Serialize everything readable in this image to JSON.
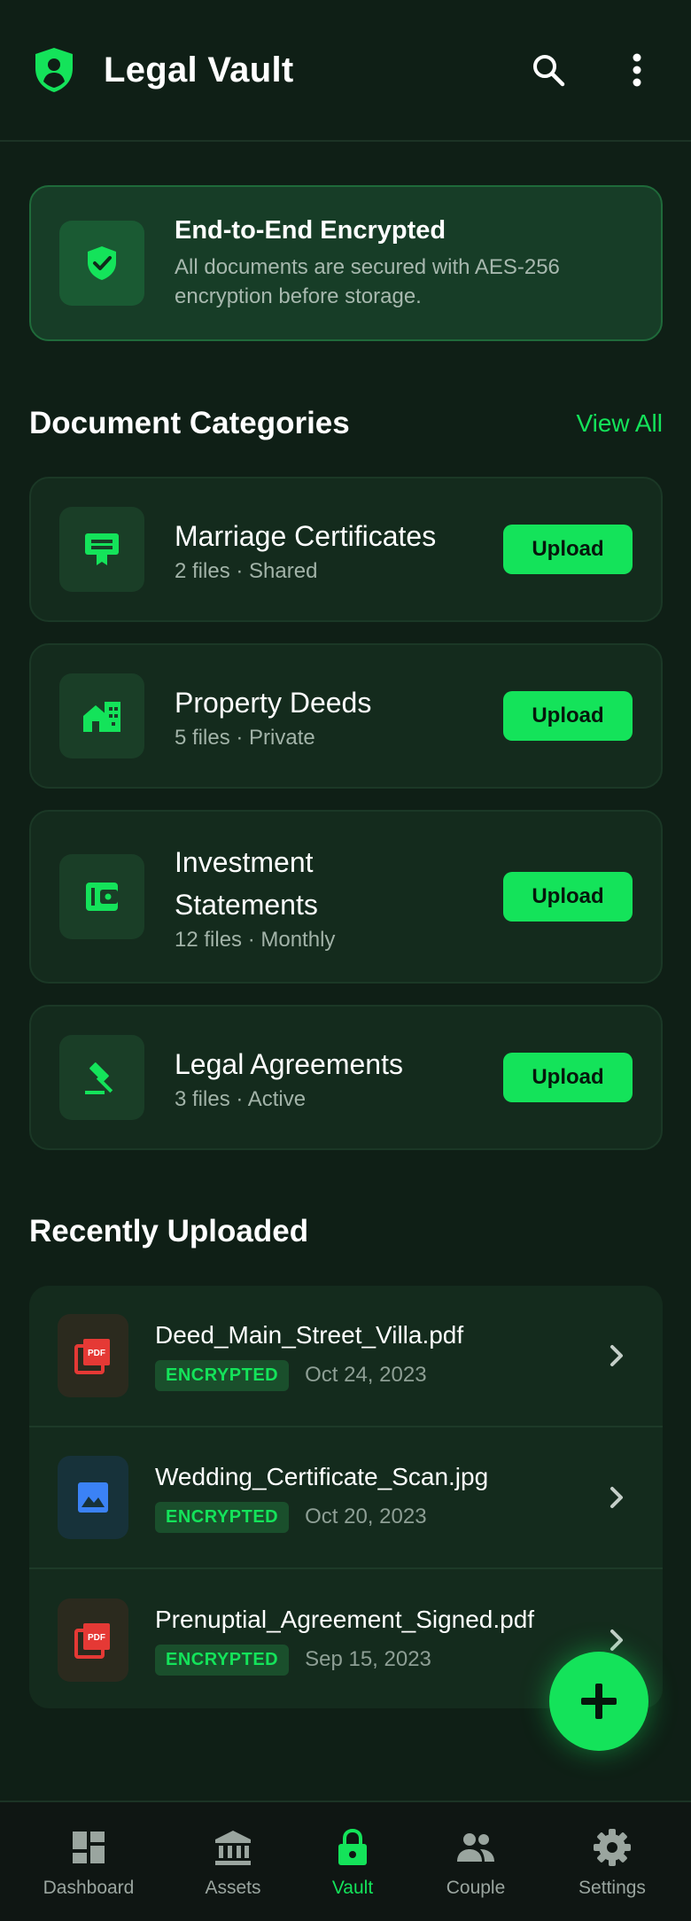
{
  "header": {
    "title": "Legal Vault",
    "brand_icon": "shield-person-icon",
    "search_icon": "search-icon",
    "more_icon": "more-vert-icon"
  },
  "banner": {
    "title": "End-to-End Encrypted",
    "description": "All documents are secured with AES-256 encryption before storage.",
    "icon": "shield-check-icon"
  },
  "categories": {
    "title": "Document Categories",
    "view_all": "View All",
    "items": [
      {
        "name": "Marriage Certificates",
        "meta": "2 files · Shared",
        "icon": "certificate-icon",
        "button": "Upload"
      },
      {
        "name": "Property Deeds",
        "meta": "5 files · Private",
        "icon": "house-icon",
        "button": "Upload"
      },
      {
        "name": "Investment Statements",
        "meta": "12 files · Monthly",
        "icon": "wallet-icon",
        "button": "Upload"
      },
      {
        "name": "Legal Agreements",
        "meta": "3 files · Active",
        "icon": "gavel-icon",
        "button": "Upload"
      }
    ]
  },
  "recent": {
    "title": "Recently Uploaded",
    "items": [
      {
        "name": "Deed_Main_Street_Villa.pdf",
        "badge": "ENCRYPTED",
        "date": "Oct 24, 2023",
        "icon": "pdf-icon"
      },
      {
        "name": "Wedding_Certificate_Scan.jpg",
        "badge": "ENCRYPTED",
        "date": "Oct 20, 2023",
        "icon": "image-icon"
      },
      {
        "name": "Prenuptial_Agreement_Signed.pdf",
        "badge": "ENCRYPTED",
        "date": "Sep 15, 2023",
        "icon": "pdf-icon"
      }
    ]
  },
  "fab": {
    "icon": "plus-icon"
  },
  "nav": {
    "items": [
      {
        "label": "Dashboard",
        "icon": "dashboard-icon"
      },
      {
        "label": "Assets",
        "icon": "bank-icon"
      },
      {
        "label": "Vault",
        "icon": "lock-icon",
        "active": true
      },
      {
        "label": "Couple",
        "icon": "people-icon"
      },
      {
        "label": "Settings",
        "icon": "gear-icon"
      }
    ]
  },
  "colors": {
    "accent": "#14e35a",
    "background": "#0f1f16",
    "card": "#142b1d",
    "pdf_red": "#e53935",
    "image_blue": "#3b82f6"
  }
}
